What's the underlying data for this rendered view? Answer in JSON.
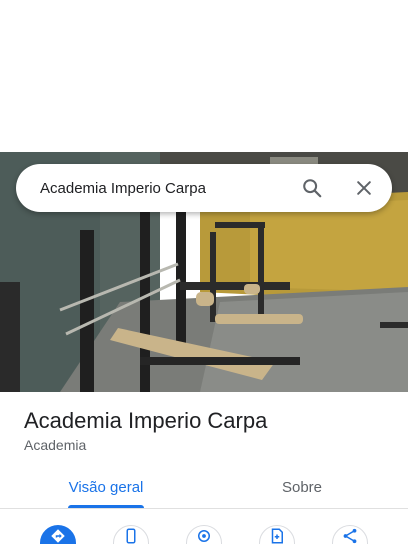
{
  "search": {
    "query": "Academia Imperio Carpa"
  },
  "place": {
    "name": "Academia Imperio Carpa",
    "category": "Academia"
  },
  "tabs": [
    {
      "label": "Visão geral",
      "active": true
    },
    {
      "label": "Sobre",
      "active": false
    }
  ],
  "actions": [
    {
      "icon": "directions-icon"
    },
    {
      "icon": "phone-icon"
    },
    {
      "icon": "location-icon"
    },
    {
      "icon": "save-icon"
    },
    {
      "icon": "share-icon"
    }
  ],
  "colors": {
    "accent": "#1a73e8",
    "text": "#202124",
    "secondary_text": "#5f6368"
  }
}
